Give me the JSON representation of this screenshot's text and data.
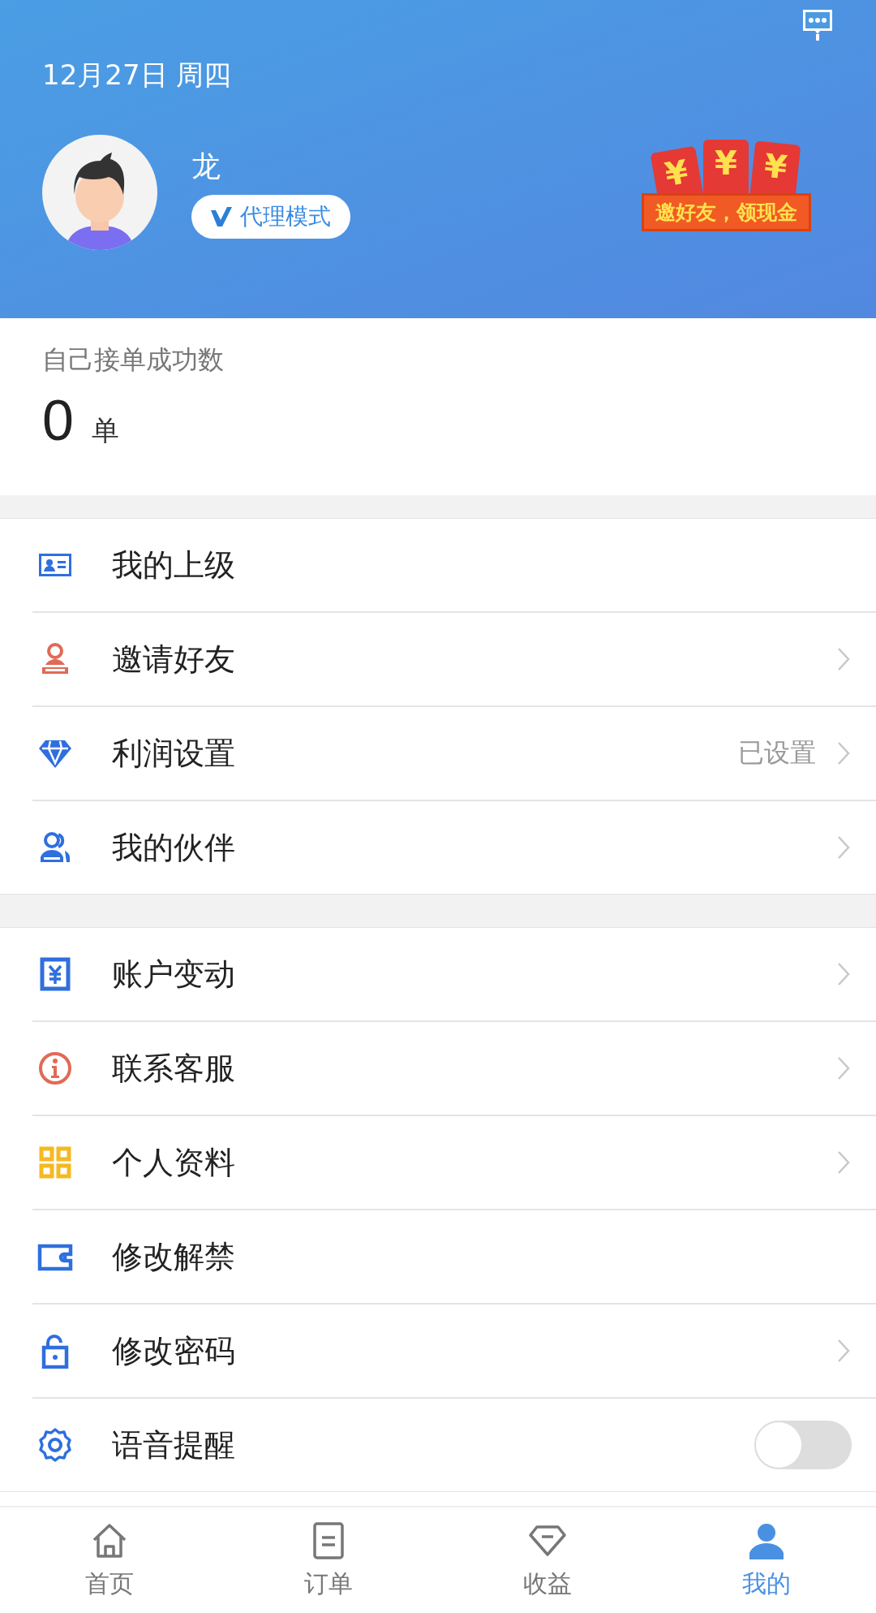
{
  "header": {
    "date": "12月27日 周四",
    "user": {
      "name": "龙",
      "mode_badge": "代理模式"
    },
    "banner": {
      "envelope_marks": [
        "¥",
        "¥",
        "¥"
      ],
      "ribbon_text": "邀好友，领现金"
    }
  },
  "stats": {
    "label": "自己接单成功数",
    "value": "0",
    "unit": "单"
  },
  "menu_groups": [
    {
      "items": [
        {
          "kind": "link",
          "label": "我的上级",
          "chevron": false
        },
        {
          "kind": "link",
          "label": "邀请好友",
          "chevron": true
        },
        {
          "kind": "link",
          "label": "利润设置",
          "value": "已设置",
          "chevron": true
        },
        {
          "kind": "link",
          "label": "我的伙伴",
          "chevron": true
        }
      ]
    },
    {
      "items": [
        {
          "kind": "link",
          "label": "账户变动",
          "chevron": true
        },
        {
          "kind": "link",
          "label": "联系客服",
          "chevron": true
        },
        {
          "kind": "link",
          "label": "个人资料",
          "chevron": true
        },
        {
          "kind": "link",
          "label": "修改解禁",
          "chevron": false
        },
        {
          "kind": "link",
          "label": "修改密码",
          "chevron": true
        },
        {
          "kind": "toggle",
          "label": "语音提醒",
          "on": false
        }
      ]
    }
  ],
  "tab_bar": [
    {
      "label": "首页",
      "selected": false
    },
    {
      "label": "订单",
      "selected": false
    },
    {
      "label": "收益",
      "selected": false
    },
    {
      "label": "我的",
      "selected": true
    }
  ]
}
